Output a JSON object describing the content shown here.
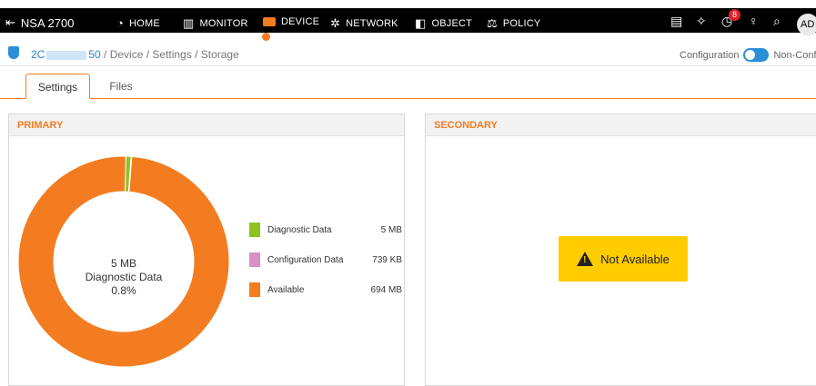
{
  "topnav": {
    "product": "NSA 2700",
    "items": [
      {
        "label": "HOME",
        "icon": "home-icon"
      },
      {
        "label": "MONITOR",
        "icon": "monitor-icon"
      },
      {
        "label": "DEVICE",
        "icon": "device-icon"
      },
      {
        "label": "NETWORK",
        "icon": "network-icon"
      },
      {
        "label": "OBJECT",
        "icon": "object-icon"
      },
      {
        "label": "POLICY",
        "icon": "policy-icon"
      }
    ],
    "active": "DEVICE",
    "notification_count": "8",
    "avatar_initials": "AD"
  },
  "breadcrumb": {
    "serial_prefix": "2C",
    "serial_suffix": "50",
    "path": " / Device / Settings / Storage"
  },
  "config_toggle": {
    "label_left": "Configuration",
    "label_right": "Non-Config"
  },
  "tabs": [
    {
      "label": "Settings",
      "active": true
    },
    {
      "label": "Files",
      "active": false
    }
  ],
  "primary": {
    "title": "PRIMARY",
    "center": {
      "size": "5 MB",
      "name": "Diagnostic Data",
      "percent": "0.8%"
    },
    "legend": [
      {
        "name": "Diagnostic Data",
        "value": "5 MB",
        "color": "#8dc21f"
      },
      {
        "name": "Configuration Data",
        "value": "739 KB",
        "color": "#d98fc7"
      },
      {
        "name": "Available",
        "value": "694 MB",
        "color": "#f47c20"
      }
    ],
    "donut_fractions": [
      0.008,
      0.001,
      0.991
    ]
  },
  "secondary": {
    "title": "SECONDARY",
    "status": "Not Available"
  },
  "colors": {
    "accent": "#f47c20",
    "blue": "#2a8ed8",
    "warning": "#ffcc00"
  }
}
